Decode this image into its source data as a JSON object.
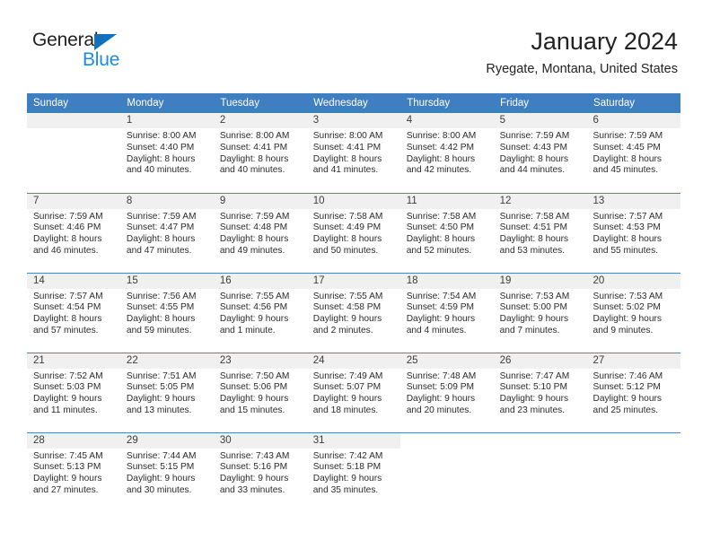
{
  "brand": {
    "name_part1": "General",
    "name_part2": "Blue",
    "triangle_icon": "triangle-icon",
    "color_dark": "#231f20",
    "color_blue": "#1b8ce3"
  },
  "header": {
    "title": "January 2024",
    "subtitle": "Ryegate, Montana, United States"
  },
  "theme": {
    "header_row_bg": "#3f7fc1",
    "header_row_text": "#ffffff",
    "week_separator": "#4a86c5",
    "daynum_band_bg": "#f0f0f0",
    "body_text": "#2b2b2b"
  },
  "calendar": {
    "weekday_headers": [
      "Sunday",
      "Monday",
      "Tuesday",
      "Wednesday",
      "Thursday",
      "Friday",
      "Saturday"
    ],
    "weeks": [
      [
        {
          "day": "",
          "lines": []
        },
        {
          "day": "1",
          "lines": [
            "Sunrise: 8:00 AM",
            "Sunset: 4:40 PM",
            "Daylight: 8 hours",
            "and 40 minutes."
          ]
        },
        {
          "day": "2",
          "lines": [
            "Sunrise: 8:00 AM",
            "Sunset: 4:41 PM",
            "Daylight: 8 hours",
            "and 40 minutes."
          ]
        },
        {
          "day": "3",
          "lines": [
            "Sunrise: 8:00 AM",
            "Sunset: 4:41 PM",
            "Daylight: 8 hours",
            "and 41 minutes."
          ]
        },
        {
          "day": "4",
          "lines": [
            "Sunrise: 8:00 AM",
            "Sunset: 4:42 PM",
            "Daylight: 8 hours",
            "and 42 minutes."
          ]
        },
        {
          "day": "5",
          "lines": [
            "Sunrise: 7:59 AM",
            "Sunset: 4:43 PM",
            "Daylight: 8 hours",
            "and 44 minutes."
          ]
        },
        {
          "day": "6",
          "lines": [
            "Sunrise: 7:59 AM",
            "Sunset: 4:45 PM",
            "Daylight: 8 hours",
            "and 45 minutes."
          ]
        }
      ],
      [
        {
          "day": "7",
          "lines": [
            "Sunrise: 7:59 AM",
            "Sunset: 4:46 PM",
            "Daylight: 8 hours",
            "and 46 minutes."
          ]
        },
        {
          "day": "8",
          "lines": [
            "Sunrise: 7:59 AM",
            "Sunset: 4:47 PM",
            "Daylight: 8 hours",
            "and 47 minutes."
          ]
        },
        {
          "day": "9",
          "lines": [
            "Sunrise: 7:59 AM",
            "Sunset: 4:48 PM",
            "Daylight: 8 hours",
            "and 49 minutes."
          ]
        },
        {
          "day": "10",
          "lines": [
            "Sunrise: 7:58 AM",
            "Sunset: 4:49 PM",
            "Daylight: 8 hours",
            "and 50 minutes."
          ]
        },
        {
          "day": "11",
          "lines": [
            "Sunrise: 7:58 AM",
            "Sunset: 4:50 PM",
            "Daylight: 8 hours",
            "and 52 minutes."
          ]
        },
        {
          "day": "12",
          "lines": [
            "Sunrise: 7:58 AM",
            "Sunset: 4:51 PM",
            "Daylight: 8 hours",
            "and 53 minutes."
          ]
        },
        {
          "day": "13",
          "lines": [
            "Sunrise: 7:57 AM",
            "Sunset: 4:53 PM",
            "Daylight: 8 hours",
            "and 55 minutes."
          ]
        }
      ],
      [
        {
          "day": "14",
          "lines": [
            "Sunrise: 7:57 AM",
            "Sunset: 4:54 PM",
            "Daylight: 8 hours",
            "and 57 minutes."
          ]
        },
        {
          "day": "15",
          "lines": [
            "Sunrise: 7:56 AM",
            "Sunset: 4:55 PM",
            "Daylight: 8 hours",
            "and 59 minutes."
          ]
        },
        {
          "day": "16",
          "lines": [
            "Sunrise: 7:55 AM",
            "Sunset: 4:56 PM",
            "Daylight: 9 hours",
            "and 1 minute."
          ]
        },
        {
          "day": "17",
          "lines": [
            "Sunrise: 7:55 AM",
            "Sunset: 4:58 PM",
            "Daylight: 9 hours",
            "and 2 minutes."
          ]
        },
        {
          "day": "18",
          "lines": [
            "Sunrise: 7:54 AM",
            "Sunset: 4:59 PM",
            "Daylight: 9 hours",
            "and 4 minutes."
          ]
        },
        {
          "day": "19",
          "lines": [
            "Sunrise: 7:53 AM",
            "Sunset: 5:00 PM",
            "Daylight: 9 hours",
            "and 7 minutes."
          ]
        },
        {
          "day": "20",
          "lines": [
            "Sunrise: 7:53 AM",
            "Sunset: 5:02 PM",
            "Daylight: 9 hours",
            "and 9 minutes."
          ]
        }
      ],
      [
        {
          "day": "21",
          "lines": [
            "Sunrise: 7:52 AM",
            "Sunset: 5:03 PM",
            "Daylight: 9 hours",
            "and 11 minutes."
          ]
        },
        {
          "day": "22",
          "lines": [
            "Sunrise: 7:51 AM",
            "Sunset: 5:05 PM",
            "Daylight: 9 hours",
            "and 13 minutes."
          ]
        },
        {
          "day": "23",
          "lines": [
            "Sunrise: 7:50 AM",
            "Sunset: 5:06 PM",
            "Daylight: 9 hours",
            "and 15 minutes."
          ]
        },
        {
          "day": "24",
          "lines": [
            "Sunrise: 7:49 AM",
            "Sunset: 5:07 PM",
            "Daylight: 9 hours",
            "and 18 minutes."
          ]
        },
        {
          "day": "25",
          "lines": [
            "Sunrise: 7:48 AM",
            "Sunset: 5:09 PM",
            "Daylight: 9 hours",
            "and 20 minutes."
          ]
        },
        {
          "day": "26",
          "lines": [
            "Sunrise: 7:47 AM",
            "Sunset: 5:10 PM",
            "Daylight: 9 hours",
            "and 23 minutes."
          ]
        },
        {
          "day": "27",
          "lines": [
            "Sunrise: 7:46 AM",
            "Sunset: 5:12 PM",
            "Daylight: 9 hours",
            "and 25 minutes."
          ]
        }
      ],
      [
        {
          "day": "28",
          "lines": [
            "Sunrise: 7:45 AM",
            "Sunset: 5:13 PM",
            "Daylight: 9 hours",
            "and 27 minutes."
          ]
        },
        {
          "day": "29",
          "lines": [
            "Sunrise: 7:44 AM",
            "Sunset: 5:15 PM",
            "Daylight: 9 hours",
            "and 30 minutes."
          ]
        },
        {
          "day": "30",
          "lines": [
            "Sunrise: 7:43 AM",
            "Sunset: 5:16 PM",
            "Daylight: 9 hours",
            "and 33 minutes."
          ]
        },
        {
          "day": "31",
          "lines": [
            "Sunrise: 7:42 AM",
            "Sunset: 5:18 PM",
            "Daylight: 9 hours",
            "and 35 minutes."
          ]
        },
        {
          "day": "",
          "lines": []
        },
        {
          "day": "",
          "lines": []
        },
        {
          "day": "",
          "lines": []
        }
      ]
    ]
  }
}
